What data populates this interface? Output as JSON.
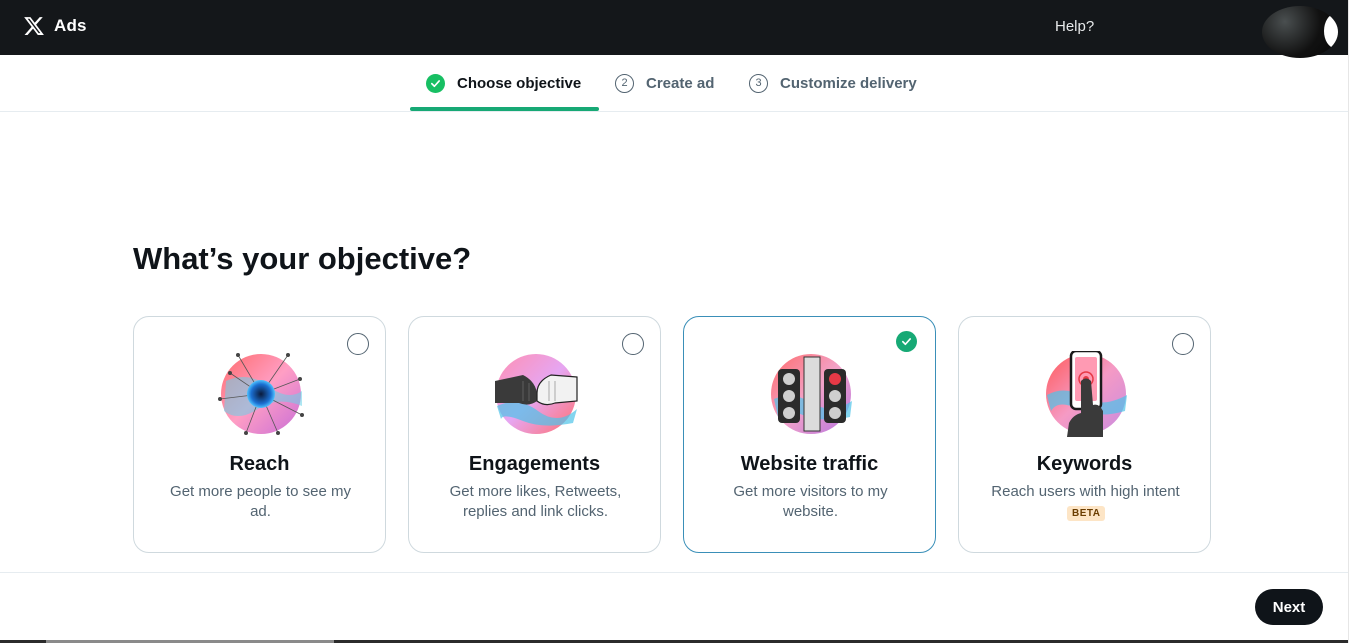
{
  "header": {
    "logo_icon": "x-logo-icon",
    "brand_label": "Ads",
    "help_label": "Help?",
    "avatar_icon": "user-avatar"
  },
  "steps": [
    {
      "label": "Choose objective",
      "status": "complete",
      "icon": "check-circle-icon"
    },
    {
      "label": "Create ad",
      "status": "pending",
      "number": "2"
    },
    {
      "label": "Customize delivery",
      "status": "pending",
      "number": "3"
    }
  ],
  "main": {
    "heading": "What’s your objective?",
    "cards": [
      {
        "title": "Reach",
        "description": "Get more people to see my ad.",
        "selected": false,
        "icon": "reach-illustration"
      },
      {
        "title": "Engagements",
        "description": "Get more likes, Retweets, replies and link clicks.",
        "selected": false,
        "icon": "fist-bump-illustration"
      },
      {
        "title": "Website traffic",
        "description": "Get more visitors to my website.",
        "selected": true,
        "icon": "traffic-light-illustration"
      },
      {
        "title": "Keywords",
        "description": "Reach users with high intent",
        "selected": false,
        "badge": "BETA",
        "icon": "phone-tap-illustration"
      }
    ]
  },
  "footer": {
    "next_label": "Next"
  },
  "colors": {
    "topbar": "#14171a",
    "accent_green": "#17a975",
    "selected_border": "#3a8fb8",
    "primary_button": "#0f1419"
  }
}
